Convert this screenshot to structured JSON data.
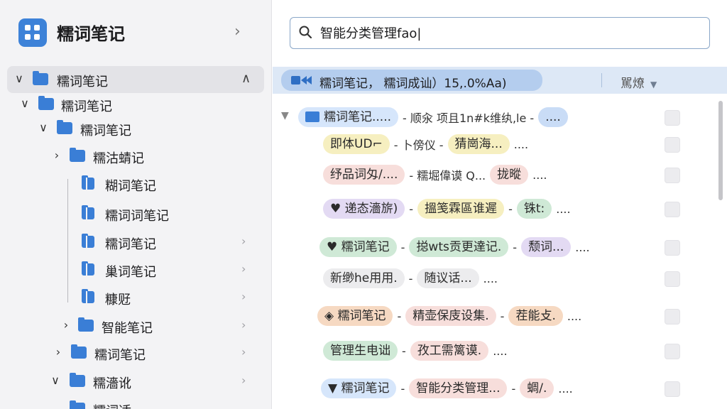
{
  "app": {
    "title": "糯词笔记",
    "logo_icon": "grid-app-icon",
    "header_chevron": "›"
  },
  "colors": {
    "accent": "#3d82d8",
    "folder": "#3a7ed6",
    "breadcrumb_bg": "#dde8f6",
    "sidebar_bg": "#f3f3f5"
  },
  "sidebar": {
    "items": [
      {
        "label": "糯词笔记",
        "toggle": "∨",
        "chevron": "∧"
      },
      {
        "label": "糯词笔记",
        "toggle": "∨",
        "chevron": ""
      },
      {
        "label": "糯词笔记",
        "toggle": "∨",
        "chevron": ""
      },
      {
        "label": "糯沽蜻记",
        "toggle": "›",
        "chevron": ""
      },
      {
        "label": "糊词笔记",
        "toggle": "",
        "chevron": ""
      },
      {
        "label": "糯词词笔记",
        "toggle": "",
        "chevron": ""
      },
      {
        "label": "糯词笔记",
        "toggle": "",
        "chevron": "›"
      },
      {
        "label": "巢词笔记",
        "toggle": "",
        "chevron": "›"
      },
      {
        "label": "糠觃",
        "toggle": "",
        "chevron": "›"
      },
      {
        "label": "智能笔记",
        "toggle": "›",
        "chevron": "›"
      },
      {
        "label": "糯词笔记",
        "toggle": "›",
        "chevron": "›"
      },
      {
        "label": "糯濇讹",
        "toggle": "∨",
        "chevron": "›"
      },
      {
        "label": "糯词适",
        "toggle": "",
        "chevron": ""
      }
    ]
  },
  "search": {
    "value": "智能分类管理fao|",
    "icon": "search-icon"
  },
  "breadcrumb": {
    "icon": "folder-arrow-icon",
    "text": "糯词笔记，  糯词成讪）15,.0%Aa)",
    "sort_label": "駡燎",
    "sort_caret": "▼"
  },
  "rows": [
    {
      "toggle": "▼",
      "chips": [
        {
          "text": "糯词笔记.....",
          "color": "c-blue",
          "icon": "folder-icon"
        },
        {
          "sep": "- 顺汆  项且1n#k维纨,le -"
        },
        {
          "text": "....",
          "color": "c-blue2"
        }
      ]
    },
    {
      "chips": [
        {
          "text": "即体UD⌐",
          "color": "c-yellow"
        },
        {
          "sep": "- 卜傍仪 -"
        },
        {
          "text": "猜崗海...",
          "color": "c-yellow"
        },
        {
          "sep": "...."
        }
      ]
    },
    {
      "chips": [
        {
          "text": "纾品词匁/....",
          "color": "c-pink"
        },
        {
          "sep": "- 糯堀偉谟 Q..."
        },
        {
          "text": "拢暰",
          "color": "c-pink"
        },
        {
          "sep": "...."
        }
      ]
    },
    {
      "chips": [
        {
          "text": "♥ 递态濇旂)",
          "color": "c-lavender"
        },
        {
          "sep": "-"
        },
        {
          "text": "搵笺霖區谁遲",
          "color": "c-yellow"
        },
        {
          "sep": "-"
        },
        {
          "text": "铢t:",
          "color": "c-green"
        },
        {
          "sep": "...."
        }
      ]
    },
    {
      "chips": [
        {
          "text": "♥ 糯词笔记",
          "color": "c-green"
        },
        {
          "sep": "-"
        },
        {
          "text": "搃wts贡更達记.",
          "color": "c-green"
        },
        {
          "sep": "-"
        },
        {
          "text": "颓词...",
          "color": "c-lavender"
        },
        {
          "sep": "...."
        }
      ]
    },
    {
      "chips": [
        {
          "text": "新缈he用用.",
          "color": "c-gray"
        },
        {
          "sep": "-"
        },
        {
          "text": "随议话...",
          "color": "c-gray"
        },
        {
          "sep": "...."
        }
      ]
    },
    {
      "chips": [
        {
          "text": "◈ 糯词笔记",
          "color": "c-peach"
        },
        {
          "sep": "-"
        },
        {
          "text": "精壶保庋设集.",
          "color": "c-pink"
        },
        {
          "sep": "-"
        },
        {
          "text": "茬能攴.",
          "color": "c-peach"
        },
        {
          "sep": "...."
        }
      ]
    },
    {
      "chips": [
        {
          "text": "管理生电诎",
          "color": "c-green"
        },
        {
          "sep": "-"
        },
        {
          "text": "孜工需篱谟.",
          "color": "c-pink"
        },
        {
          "sep": "...."
        }
      ]
    },
    {
      "chips": [
        {
          "text": "▼ 糯词笔记",
          "color": "c-blue"
        },
        {
          "sep": "-"
        },
        {
          "text": "智能分类管理...",
          "color": "c-pink"
        },
        {
          "sep": "-"
        },
        {
          "text": "蜩/.",
          "color": "c-pink"
        },
        {
          "sep": "...."
        }
      ]
    }
  ]
}
